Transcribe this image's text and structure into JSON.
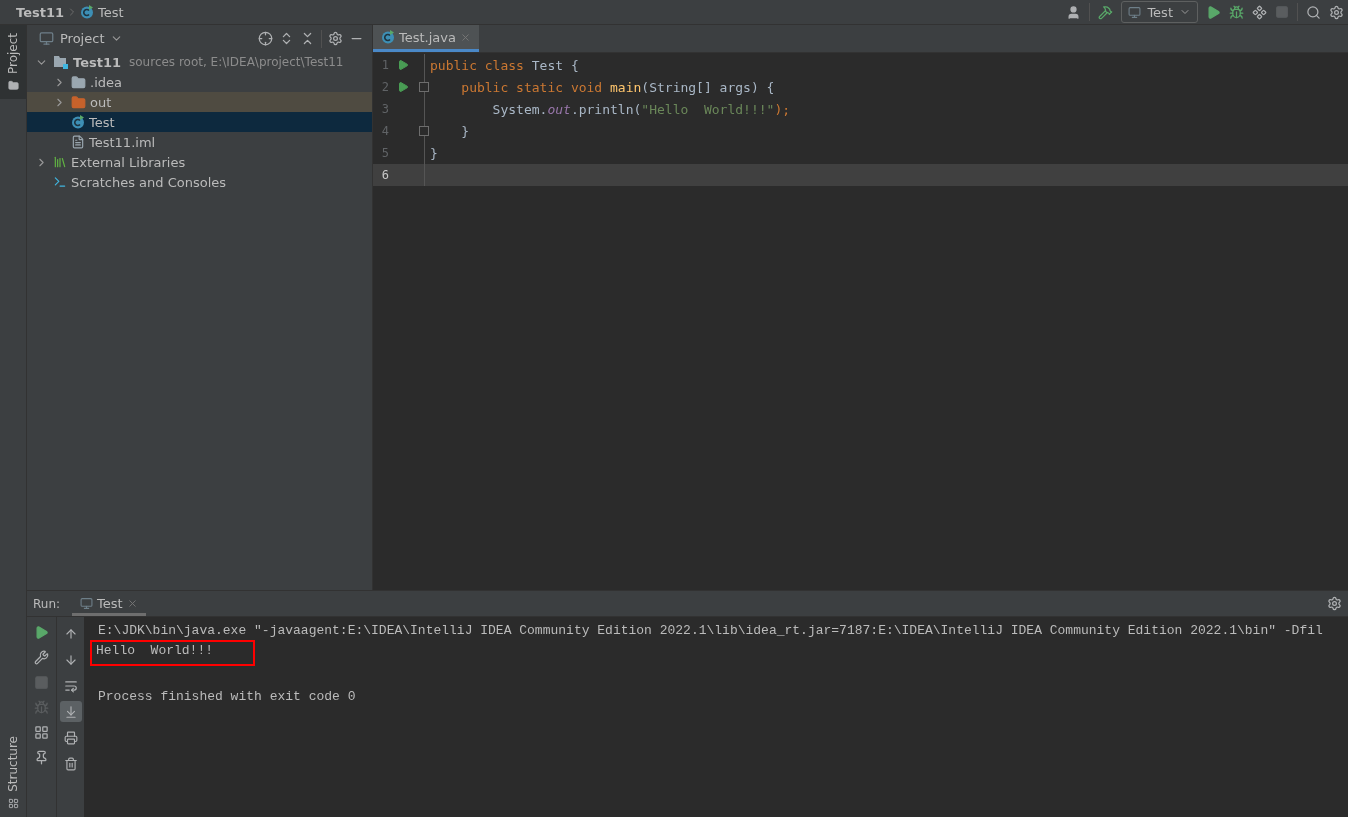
{
  "breadcrumbs": [
    {
      "label": "Test11",
      "kind": "project"
    },
    {
      "label": "Test",
      "kind": "class"
    }
  ],
  "toolbar": {
    "run_config": "Test"
  },
  "left_strip": {
    "tabs": [
      {
        "label": "Project",
        "selected": true
      }
    ],
    "bottom_tabs": [
      {
        "label": "Structure",
        "selected": false
      }
    ]
  },
  "project_panel": {
    "title": "Project",
    "tree": [
      {
        "label": "Test11",
        "kind": "module",
        "hint": "sources root,  E:\\IDEA\\project\\Test11",
        "expanded": true,
        "selected": false,
        "children": [
          {
            "label": ".idea",
            "kind": "folder",
            "expanded": false,
            "selected": false
          },
          {
            "label": "out",
            "kind": "excluded-folder",
            "expanded": false,
            "selected": false
          },
          {
            "label": "Test",
            "kind": "class",
            "selected": true
          },
          {
            "label": "Test11.iml",
            "kind": "file",
            "selected": false
          }
        ]
      },
      {
        "label": "External Libraries",
        "kind": "libraries",
        "expanded": false,
        "selected": false
      },
      {
        "label": "Scratches and Consoles",
        "kind": "scratches",
        "selected": false
      }
    ]
  },
  "editor": {
    "tabs": [
      {
        "label": "Test.java",
        "selected": true
      }
    ],
    "lines": [
      {
        "number": "1",
        "run": true,
        "fold": false,
        "current": false,
        "tokens": [
          {
            "text": "public class ",
            "kind": "keyword"
          },
          {
            "text": "Test {",
            "kind": "plain"
          }
        ]
      },
      {
        "number": "2",
        "run": true,
        "fold": true,
        "current": false,
        "tokens": [
          {
            "text": "    public static void ",
            "kind": "keyword"
          },
          {
            "text": "main",
            "kind": "method"
          },
          {
            "text": "(String[] args) {",
            "kind": "plain"
          }
        ]
      },
      {
        "number": "3",
        "run": false,
        "fold": false,
        "current": false,
        "tokens": [
          {
            "text": "        System.",
            "kind": "plain"
          },
          {
            "text": "out",
            "kind": "field"
          },
          {
            "text": ".println(",
            "kind": "plain"
          },
          {
            "text": "\"Hello  World!!!\"",
            "kind": "string"
          },
          {
            "text": ");",
            "kind": "keyword"
          }
        ]
      },
      {
        "number": "4",
        "run": false,
        "fold": true,
        "current": false,
        "tokens": [
          {
            "text": "    }",
            "kind": "plain"
          }
        ]
      },
      {
        "number": "5",
        "run": false,
        "fold": false,
        "current": false,
        "tokens": [
          {
            "text": "}",
            "kind": "plain"
          }
        ]
      },
      {
        "number": "6",
        "run": false,
        "fold": false,
        "current": true
      }
    ]
  },
  "run_panel": {
    "label": "Run:",
    "tabs": [
      {
        "label": "Test",
        "selected": true
      }
    ],
    "actions": [
      {
        "kind": "rerun",
        "disabled": false
      },
      {
        "kind": "settings",
        "disabled": false
      },
      {
        "kind": "stop",
        "disabled": true
      },
      {
        "kind": "debug",
        "disabled": true
      },
      {
        "kind": "layout",
        "disabled": false
      },
      {
        "kind": "pin",
        "disabled": false
      }
    ],
    "console_actions": [
      {
        "kind": "up",
        "on": false
      },
      {
        "kind": "down",
        "on": false
      },
      {
        "kind": "wrap",
        "on": false
      },
      {
        "kind": "scroll-end",
        "on": true
      },
      {
        "kind": "print",
        "on": false
      },
      {
        "kind": "clear",
        "on": false
      }
    ],
    "output": [
      {
        "kind": "plain",
        "text": "E:\\JDK\\bin\\java.exe \"-javaagent:E:\\IDEA\\IntelliJ IDEA Community Edition 2022.1\\lib\\idea_rt.jar=7187:E:\\IDEA\\IntelliJ IDEA Community Edition 2022.1\\bin\" -Dfil"
      },
      {
        "kind": "framed",
        "text": "Hello  World!!!"
      },
      {
        "kind": "blank"
      },
      {
        "kind": "plain",
        "text": "Process finished with exit code 0"
      }
    ]
  }
}
